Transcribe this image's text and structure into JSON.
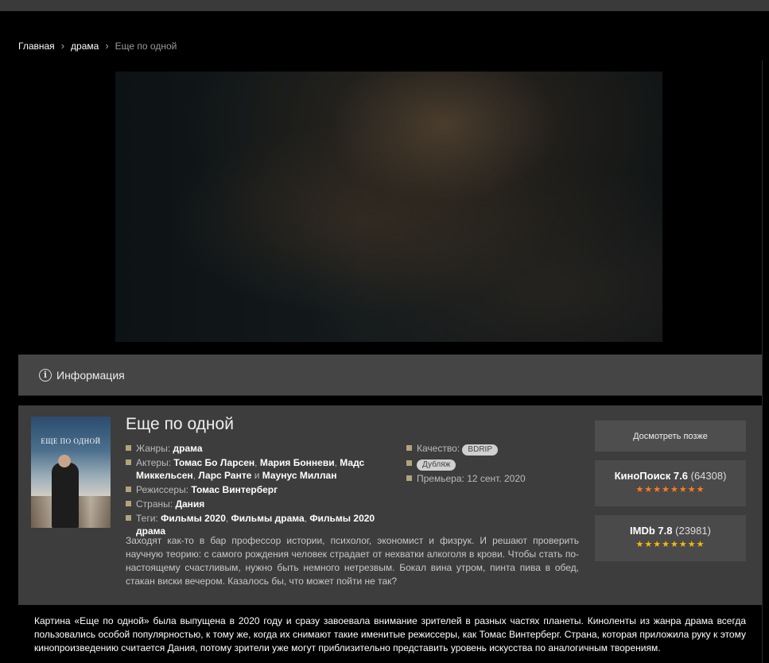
{
  "breadcrumb": {
    "home": "Главная",
    "category": "драма",
    "current": "Еще по одной"
  },
  "info_tab": {
    "icon": "info-icon",
    "label": "Информация"
  },
  "movie": {
    "title": "Еще по одной",
    "poster_title": "ЕЩЕ ПО ОДНОЙ",
    "genres_label": "Жанры:",
    "genres": "драма",
    "actors_label": "Актеры:",
    "actors": [
      "Томас Бо Ларсен",
      "Мария Бонневи",
      "Мадс Миккельсен",
      "Ларс Ранте",
      "Маунус Миллан"
    ],
    "and_word": "и",
    "directors_label": "Режиссеры:",
    "directors": "Томас Винтерберг",
    "countries_label": "Страны:",
    "countries": "Дания",
    "tags_label": "Теги:",
    "tags": [
      "Фильмы 2020",
      "Фильмы драма",
      "Фильмы 2020 драма"
    ],
    "quality_label": "Качество:",
    "quality": "BDRIP",
    "dub": "Дубляж",
    "premiere_label": "Премьера:",
    "premiere": "12 сент. 2020",
    "description": "Заходят как-то в бар профессор истории, психолог, экономист и физрук. И решают проверить научную теорию: с самого рождения человек страдает от нехватки алкоголя в крови. Чтобы стать по-настоящему счастливым, нужно быть немного нетрезвым. Бокал вина утром, пинта пива в обед, стакан виски вечером. Казалось бы, что может пойти не так?"
  },
  "sidebar": {
    "watch_later": "Досмотреть позже",
    "kinopoisk": {
      "name": "КиноПоиск 7.6",
      "count": "(64308)",
      "stars": 8,
      "star_color": "#ff7c1f"
    },
    "imdb": {
      "name": "IMDb 7.8",
      "count": "(23981)",
      "stars": 8,
      "star_color": "#f2b90f"
    }
  },
  "about": "Картина «Еще по одной» была выпущена в 2020 году и сразу завоевала внимание зрителей в разных частях планеты. Киноленты из жанра драма всегда пользовались особой популярностью, к тому же, когда их снимают такие именитые режиссеры, как Томас Винтерберг. Страна, которая приложила руку к этому кинопроизведению считается Дания, потому зрители уже могут приблизительно представить уровень искусства по аналогичным творениям."
}
